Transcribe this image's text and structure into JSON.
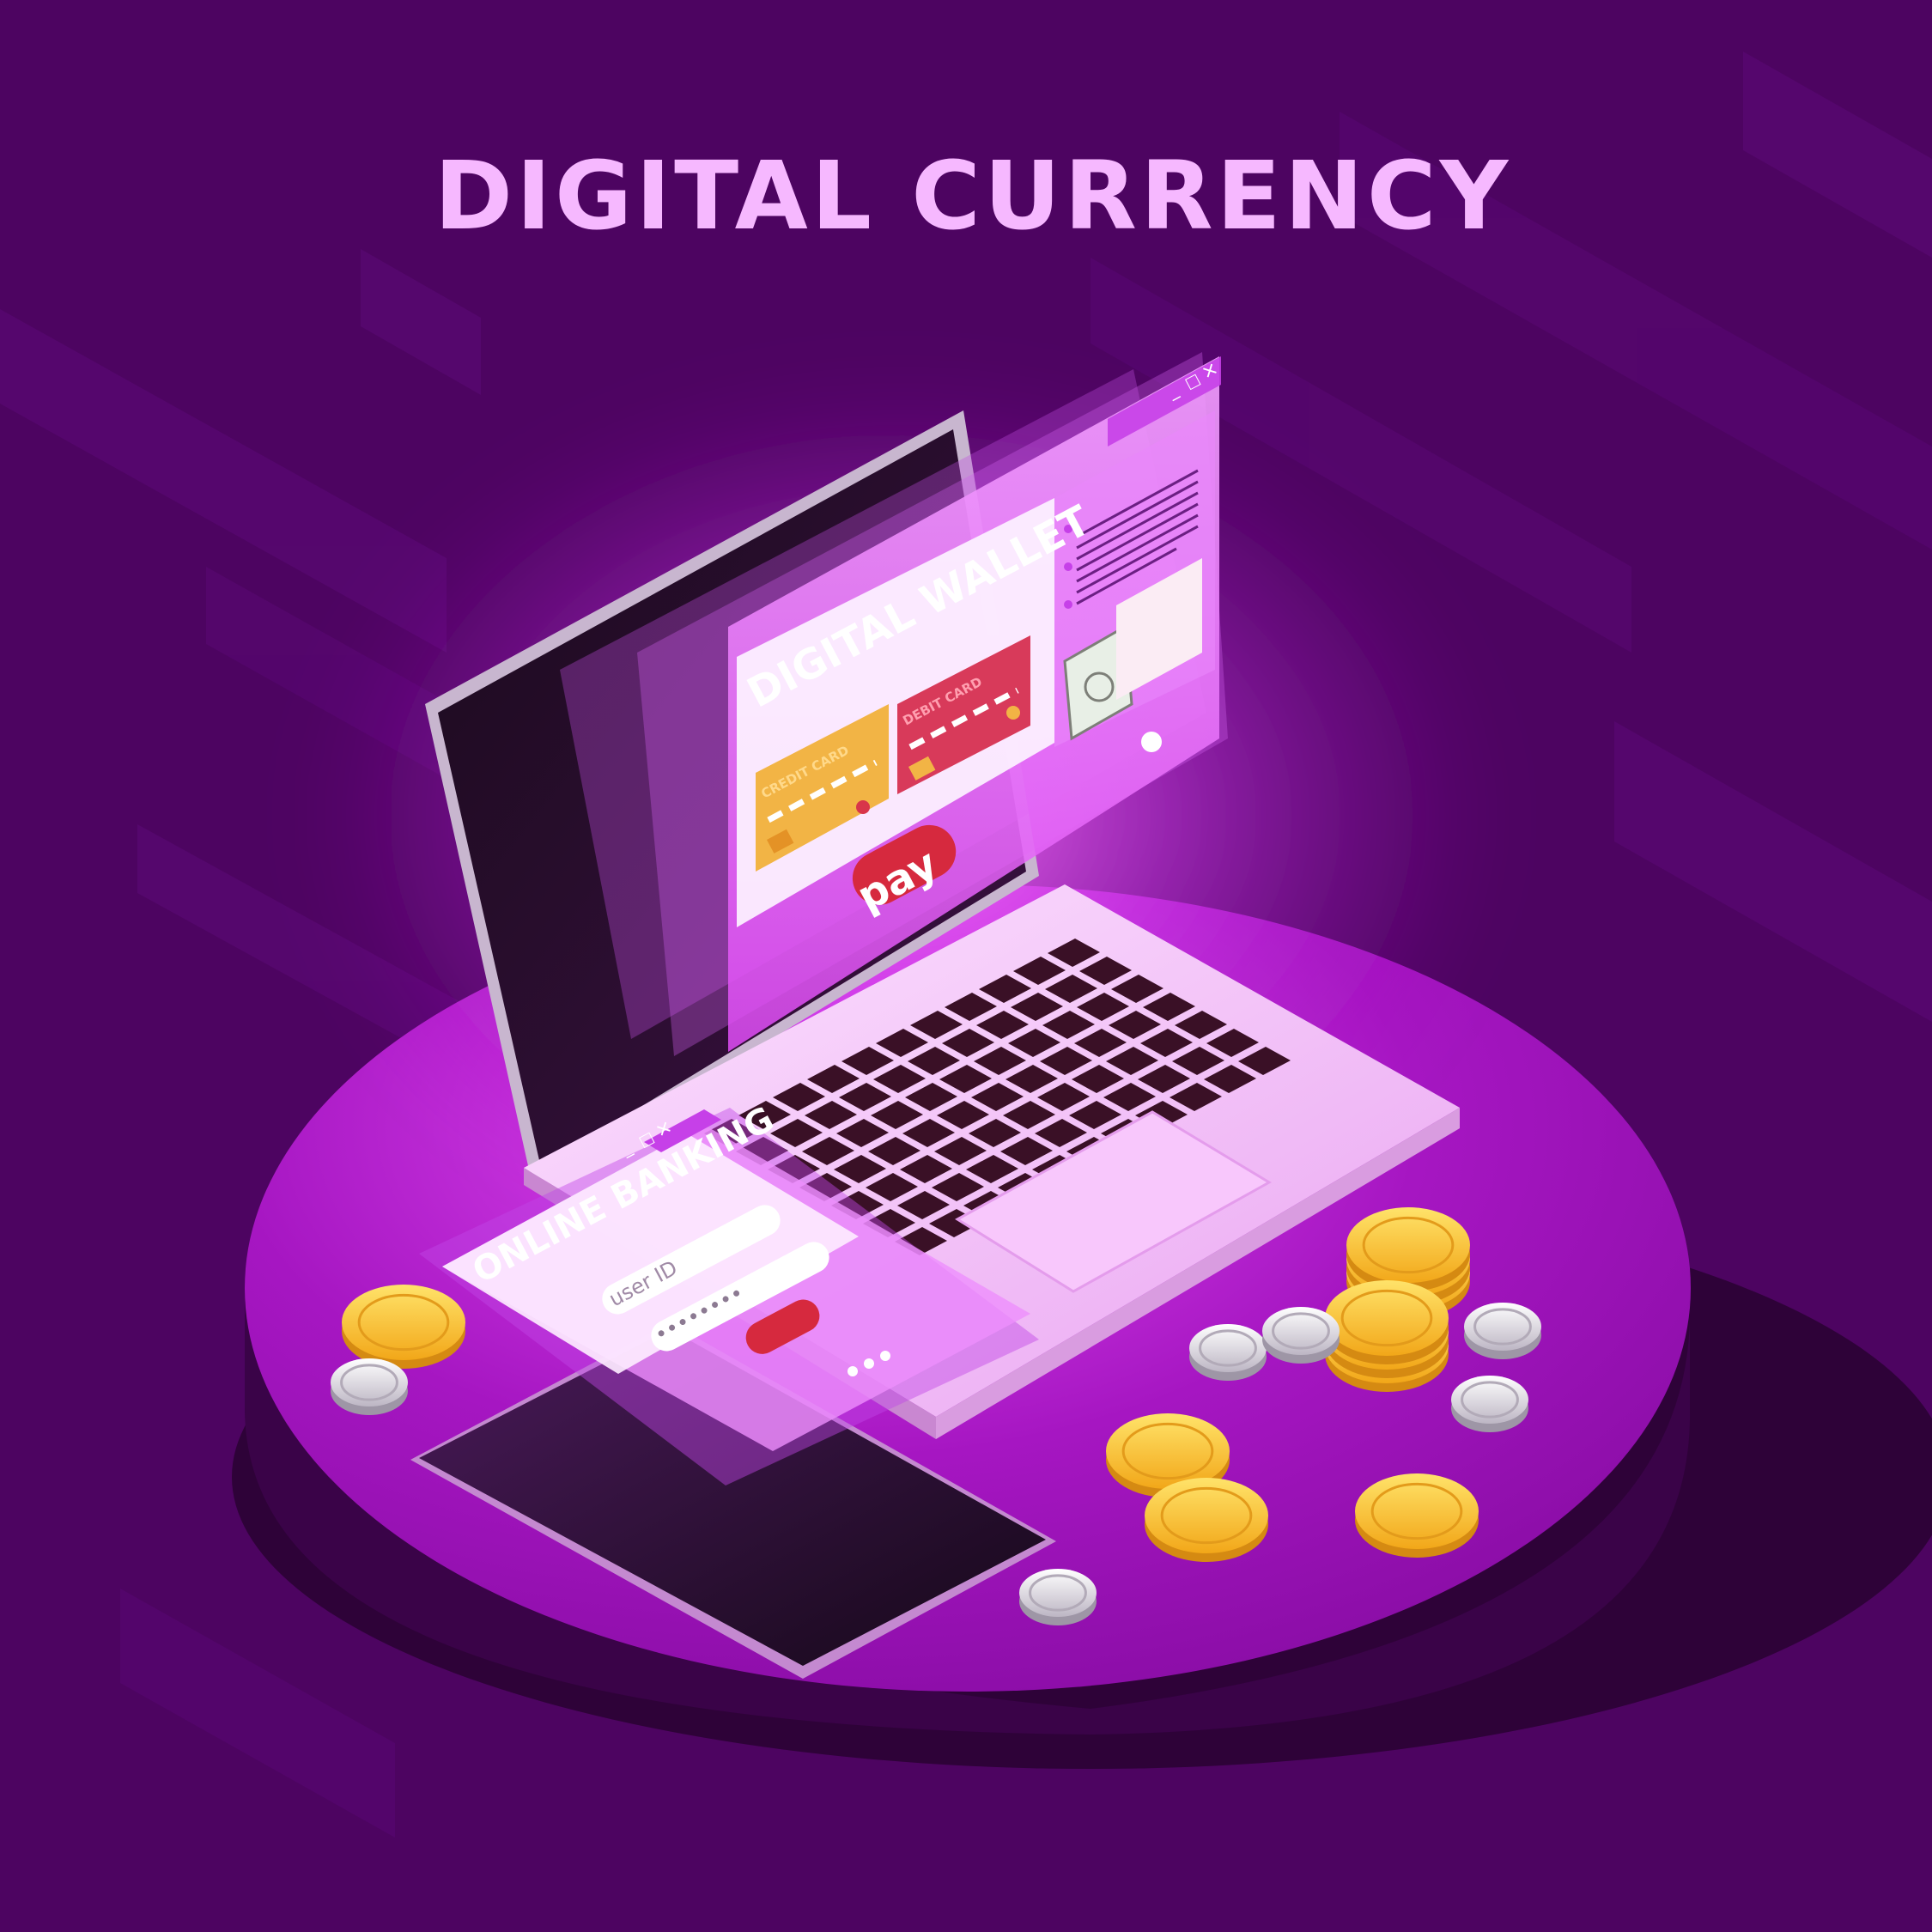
{
  "title": "DIGITAL CURRENCY",
  "wallet_window": {
    "heading": "DIGITAL WALLET",
    "credit_card_label": "CREDIT CARD",
    "debit_card_label": "DEBIT CARD",
    "pay_button": "pay"
  },
  "banking_window": {
    "heading": "ONLINE BANKING",
    "user_id_placeholder": "user ID",
    "password_mask": "••••••••"
  },
  "window_controls": {
    "minimize": "_",
    "maximize": "□",
    "close": "×"
  },
  "colors": {
    "background": "#4d0461",
    "title": "#f6b8ff",
    "platform": "#9c12b8",
    "laptop_body": "#f6c9fb",
    "keys": "#3a1026",
    "credit_card": "#f2b445",
    "debit_card": "#d83a5a",
    "pay_button": "#d6293e",
    "gold_coin": "#f7c22d",
    "silver_coin": "#d9d6dc"
  },
  "icons": [
    "gold-coin-icon",
    "silver-coin-icon",
    "banknote-icon",
    "credit-card-icon",
    "window-close-icon",
    "window-minimize-icon",
    "window-maximize-icon"
  ]
}
